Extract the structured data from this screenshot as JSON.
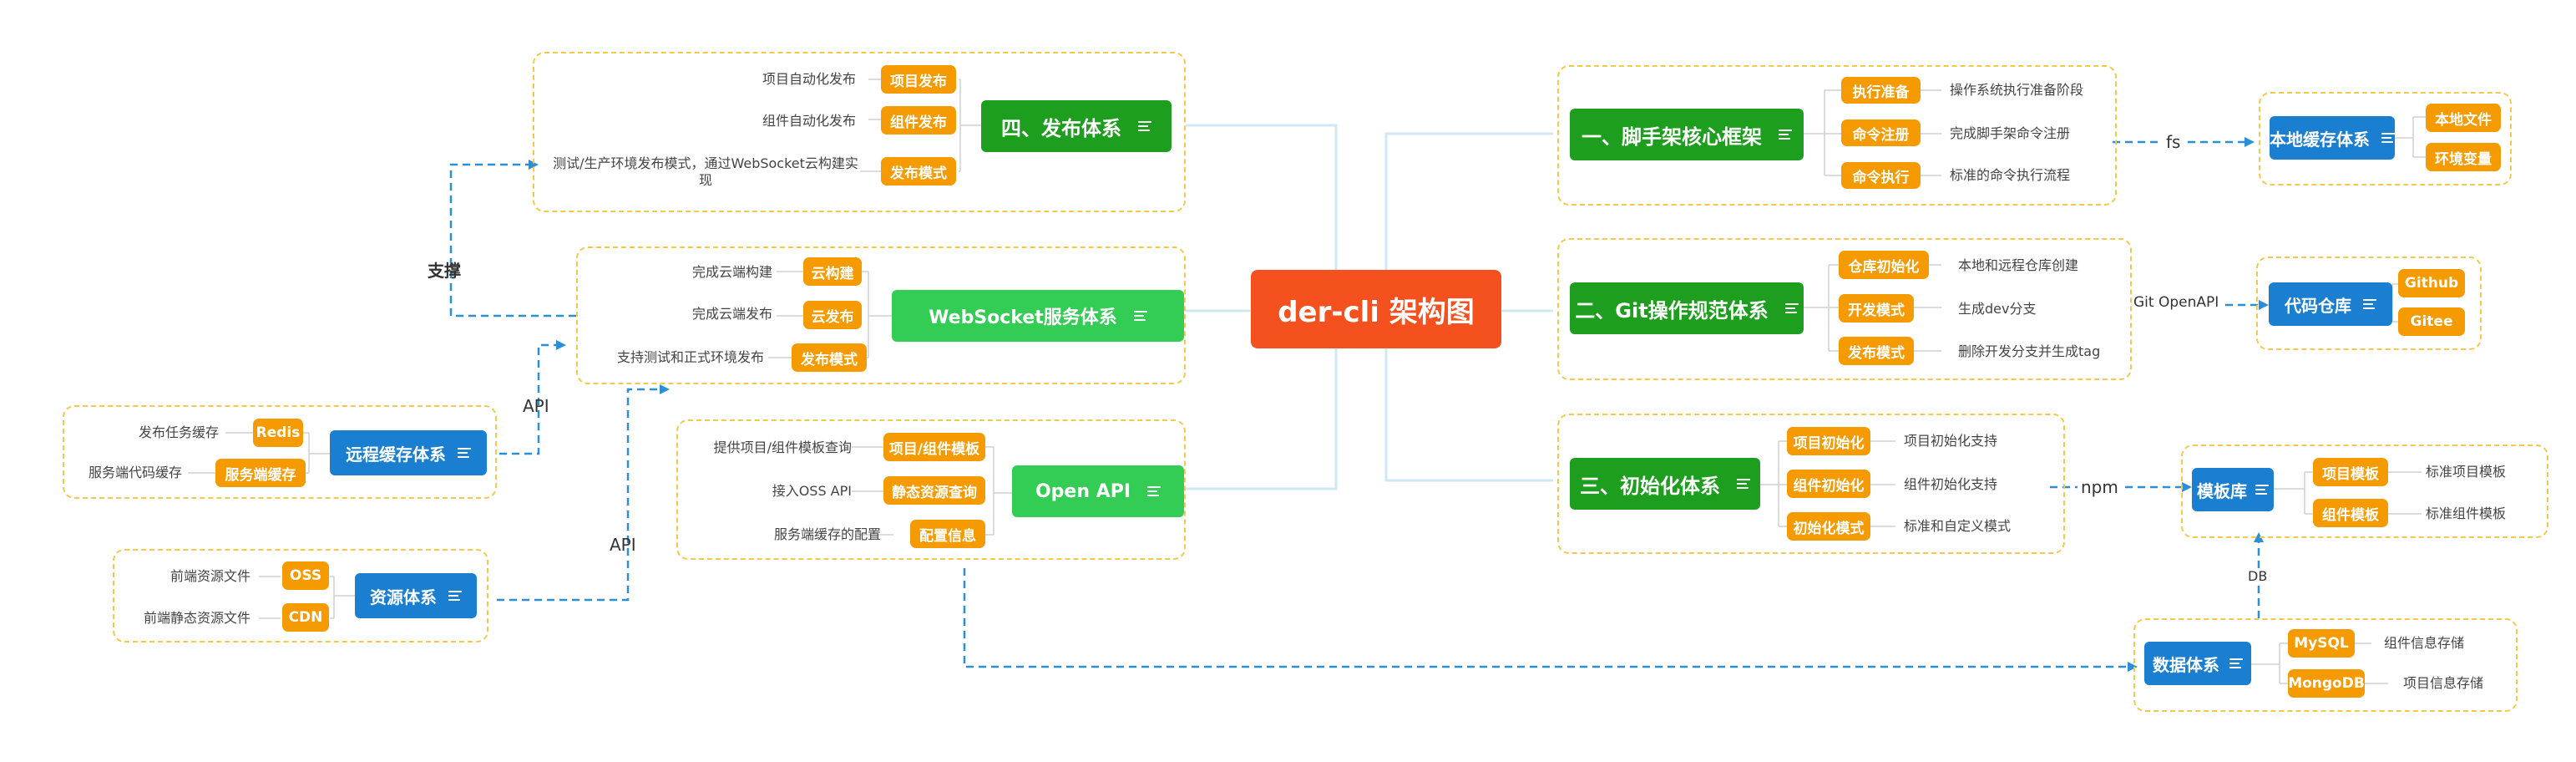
{
  "center": {
    "label": "der-cli 架构图"
  },
  "right": {
    "scaffold": {
      "title": "一、脚手架核心框架",
      "items": [
        {
          "tag": "执行准备",
          "desc": "操作系统执行准备阶段"
        },
        {
          "tag": "命令注册",
          "desc": "完成脚手架命令注册"
        },
        {
          "tag": "命令执行",
          "desc": "标准的命令执行流程"
        }
      ]
    },
    "git": {
      "title": "二、Git操作规范体系",
      "items": [
        {
          "tag": "仓库初始化",
          "desc": "本地和远程仓库创建"
        },
        {
          "tag": "开发模式",
          "desc": "生成dev分支"
        },
        {
          "tag": "发布模式",
          "desc": "删除开发分支并生成tag"
        }
      ]
    },
    "init": {
      "title": "三、初始化体系",
      "items": [
        {
          "tag": "项目初始化",
          "desc": "项目初始化支持"
        },
        {
          "tag": "组件初始化",
          "desc": "组件初始化支持"
        },
        {
          "tag": "初始化模式",
          "desc": "标准和自定义模式"
        }
      ]
    },
    "local_cache": {
      "title": "本地缓存体系",
      "tags": [
        "本地文件",
        "环境变量"
      ]
    },
    "repo": {
      "title": "代码仓库",
      "tags": [
        "Github",
        "Gitee"
      ]
    },
    "template": {
      "title": "模板库",
      "items": [
        {
          "tag": "项目模板",
          "desc": "标准项目模板"
        },
        {
          "tag": "组件模板",
          "desc": "标准组件模板"
        }
      ]
    },
    "data": {
      "title": "数据体系",
      "items": [
        {
          "tag": "MySQL",
          "desc": "组件信息存储"
        },
        {
          "tag": "MongoDB",
          "desc": "项目信息存储"
        }
      ]
    }
  },
  "left": {
    "publish": {
      "title": "四、发布体系",
      "items": [
        {
          "tag": "项目发布",
          "desc": "项目自动化发布"
        },
        {
          "tag": "组件发布",
          "desc": "组件自动化发布"
        },
        {
          "tag": "发布模式",
          "desc": "测试/生产环境发布模式，通过WebSocket云构建实现"
        }
      ]
    },
    "websocket": {
      "title": "WebSocket服务体系",
      "items": [
        {
          "tag": "云构建",
          "desc": "完成云端构建"
        },
        {
          "tag": "云发布",
          "desc": "完成云端发布"
        },
        {
          "tag": "发布模式",
          "desc": "支持测试和正式环境发布"
        }
      ]
    },
    "openapi": {
      "title": "Open API",
      "items": [
        {
          "tag": "项目/组件模板",
          "desc": "提供项目/组件模板查询"
        },
        {
          "tag": "静态资源查询",
          "desc": "接入OSS API"
        },
        {
          "tag": "配置信息",
          "desc": "服务端缓存的配置"
        }
      ]
    },
    "remote_cache": {
      "title": "远程缓存体系",
      "items": [
        {
          "tag": "Redis",
          "desc": "发布任务缓存"
        },
        {
          "tag": "服务端缓存",
          "desc": "服务端代码缓存"
        }
      ]
    },
    "resource": {
      "title": "资源体系",
      "items": [
        {
          "tag": "OSS",
          "desc": "前端资源文件"
        },
        {
          "tag": "CDN",
          "desc": "前端静态资源文件"
        }
      ]
    }
  },
  "edges": {
    "support": "支撑",
    "api1": "API",
    "api2": "API",
    "fs": "fs",
    "git_openapi": "Git OpenAPI",
    "npm": "npm",
    "db": "DB"
  },
  "colors": {
    "dark_green": "#1e9e1e",
    "light_green": "#33cc55",
    "blue": "#1a7fd1",
    "orange": "#f59a00",
    "center": "#f4511e",
    "group_border": "#f4c84a",
    "dashed_link": "#2a8fd8"
  }
}
